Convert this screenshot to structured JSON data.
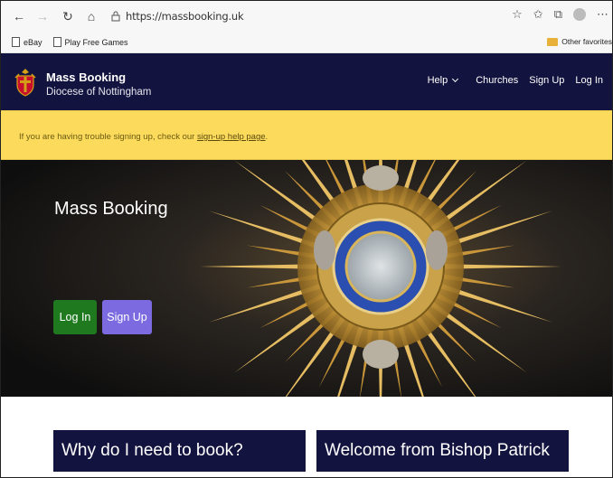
{
  "browser": {
    "url": "https://massbooking.uk",
    "favorites": [
      {
        "label": "eBay"
      },
      {
        "label": "Play Free Games"
      }
    ],
    "other_favorites": "Other favorites"
  },
  "navbar": {
    "title": "Mass Booking",
    "subtitle": "Diocese of Nottingham",
    "links": {
      "help": "Help",
      "churches": "Churches",
      "signup": "Sign Up",
      "login": "Log In"
    }
  },
  "alert": {
    "text": "If you are having trouble signing up, check our ",
    "link": "sign-up help page",
    "suffix": "."
  },
  "hero": {
    "title": "Mass Booking",
    "login_button": "Log In",
    "signup_button": "Sign Up"
  },
  "cards": {
    "why": "Why do I need to book?",
    "welcome": "Welcome from Bishop Patrick"
  },
  "colors": {
    "navbar": "#13133f",
    "alert": "#fcdb5c",
    "login": "#1f7a1f",
    "signup": "#7c6be0"
  },
  "icons": [
    "back-arrow-icon",
    "forward-arrow-icon",
    "refresh-icon",
    "home-icon",
    "lock-icon",
    "star-icon",
    "favorites-icon",
    "collections-icon",
    "profile-icon",
    "more-icon",
    "folder-icon",
    "diocese-crest-icon"
  ]
}
